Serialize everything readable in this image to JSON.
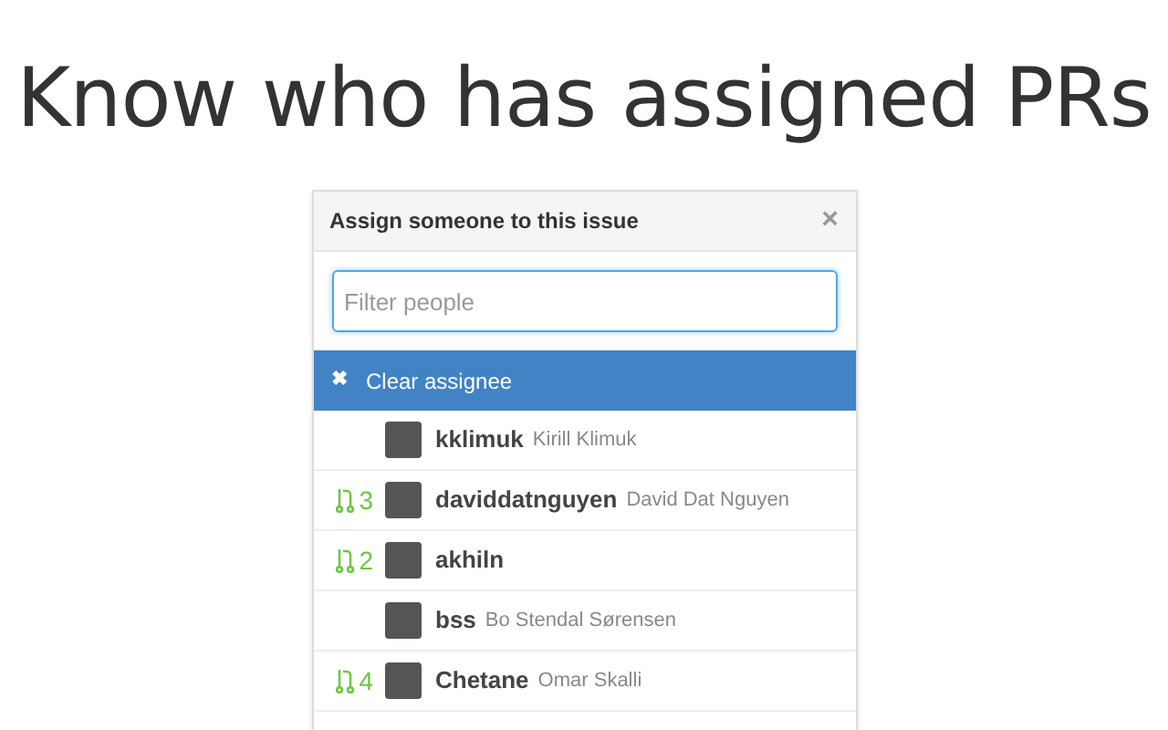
{
  "headline": "Know who has assigned PRs",
  "popup": {
    "title": "Assign someone to this issue",
    "close": "×",
    "filter": {
      "placeholder": "Filter people"
    },
    "clear": {
      "icon": "✖",
      "label": "Clear assignee",
      "selected": true
    },
    "users": [
      {
        "login": "kklimuk",
        "name": "Kirill Klimuk"
      },
      {
        "login": "daviddatnguyen",
        "name": "David Dat Nguyen",
        "pr_count": "3"
      },
      {
        "login": "akhiln",
        "pr_count": "2"
      },
      {
        "login": "bss",
        "name": "Bo Stendal Sørensen"
      },
      {
        "login": "Chetane",
        "name": "Omar Skalli",
        "pr_count": "4"
      }
    ]
  }
}
